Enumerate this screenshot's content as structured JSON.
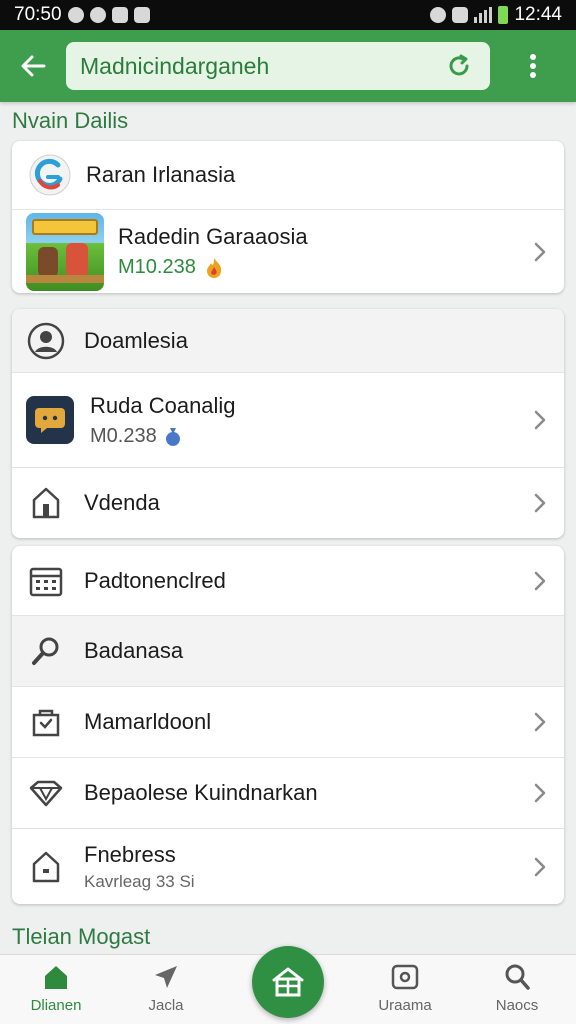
{
  "status_bar": {
    "time": "70:50",
    "clock": "12:44"
  },
  "app_bar": {
    "search_value": "Madnicindarganeh"
  },
  "sections": {
    "first_title": "Nvain Dailis",
    "bottom_title": "Tleian Mogast"
  },
  "card1": {
    "header": "Raran Irlanasia",
    "app": {
      "title": "Radedin Garaaosia",
      "subtitle": "M10.238"
    }
  },
  "card2": {
    "header": "Doamlesia",
    "app": {
      "title": "Ruda Coanalig",
      "subtitle": "M0.238"
    },
    "item": {
      "title": "Vdenda"
    }
  },
  "card3": {
    "items": [
      {
        "title": "Padtonenclred",
        "icon": "calendar-icon"
      },
      {
        "title": "Badanasa",
        "icon": "search-icon"
      },
      {
        "title": "Mamarldoonl",
        "icon": "bag-icon"
      },
      {
        "title": "Bepaolese Kuindnarkan",
        "icon": "diamond-icon"
      },
      {
        "title": "Fnebress",
        "subtitle": "Kavrleag 33 Si",
        "icon": "house-icon"
      }
    ]
  },
  "bottom_nav": {
    "items": [
      {
        "label": "Dlianen",
        "icon": "home-icon",
        "active": true
      },
      {
        "label": "Jacla",
        "icon": "send-icon"
      },
      {
        "label": "Uraama",
        "icon": "media-icon"
      },
      {
        "label": "Naocs",
        "icon": "search-icon"
      }
    ],
    "center_icon": "store-icon"
  },
  "colors": {
    "primary": "#3f9d4e",
    "accent": "#2e8b3e",
    "background": "#eef0f0"
  }
}
